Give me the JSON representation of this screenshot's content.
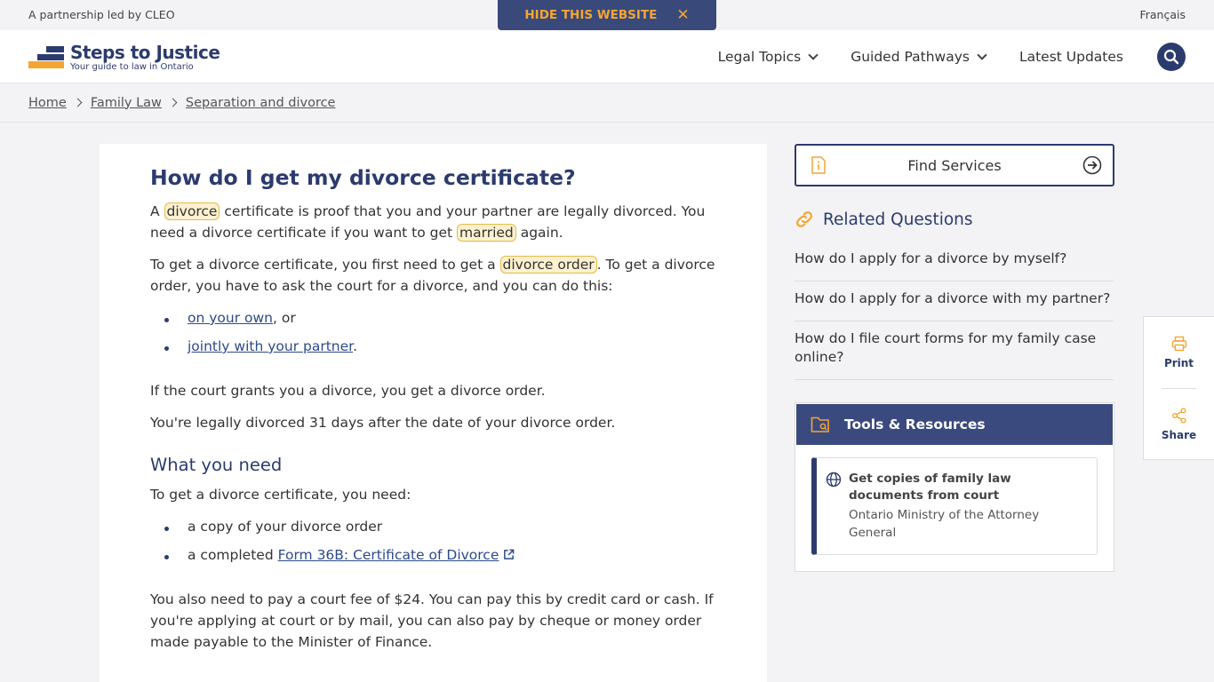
{
  "topbar": {
    "partnership": "A partnership led by CLEO",
    "hide_label": "HIDE THIS WEBSITE",
    "language": "Français"
  },
  "header": {
    "logo_title": "Steps to Justice",
    "logo_subtitle": "Your guide to law in Ontario",
    "nav": [
      {
        "label": "Legal Topics"
      },
      {
        "label": "Guided Pathways"
      },
      {
        "label": "Latest Updates"
      }
    ]
  },
  "breadcrumb": [
    "Home",
    "Family Law",
    "Separation and divorce"
  ],
  "article": {
    "title": "How do I get my divorce certificate?",
    "p1_a": "A ",
    "p1_term1": "divorce",
    "p1_b": " certificate is proof that you and your partner are legally divorced. You need a divorce certificate if you want to get ",
    "p1_term2": "married",
    "p1_c": " again.",
    "p2_a": "To get a divorce certificate, you first need to get a ",
    "p2_term": "divorce order",
    "p2_b": ". To get a divorce order, you have to ask the court for a divorce, and you can do this:",
    "list1": [
      {
        "link": "on your own",
        "after": ", or"
      },
      {
        "link": "jointly with your partner",
        "after": "."
      }
    ],
    "p3": "If the court grants you a divorce, you get a divorce order.",
    "p4": "You're legally divorced 31 days after the date of your divorce order.",
    "h2": "What you need",
    "p5": "To get a divorce certificate, you need:",
    "list2_item1": "a copy of your divorce order",
    "list2_item2_prefix": "a completed ",
    "list2_item2_link": "Form 36B: Certificate of Divorce",
    "p6": "You also need to pay a court fee of $24. You can pay this by credit card or cash. If you're applying at court or by mail, you can also pay by cheque or money order made payable to the Minister of Finance."
  },
  "sidebar": {
    "find_services": "Find Services",
    "related_title": "Related Questions",
    "related": [
      "How do I apply for a divorce by myself?",
      "How do I apply for a divorce with my partner?",
      "How do I file court forms for my family case online?"
    ],
    "tools_title": "Tools & Resources",
    "resource_title": "Get copies of family law documents from court",
    "resource_source": "Ontario Ministry of the Attorney General"
  },
  "share_panel": {
    "print": "Print",
    "share": "Share"
  },
  "colors": {
    "brand_navy": "#2c3b6e",
    "accent_orange": "#f5a533",
    "highlight_bg": "#fdf1cf"
  }
}
